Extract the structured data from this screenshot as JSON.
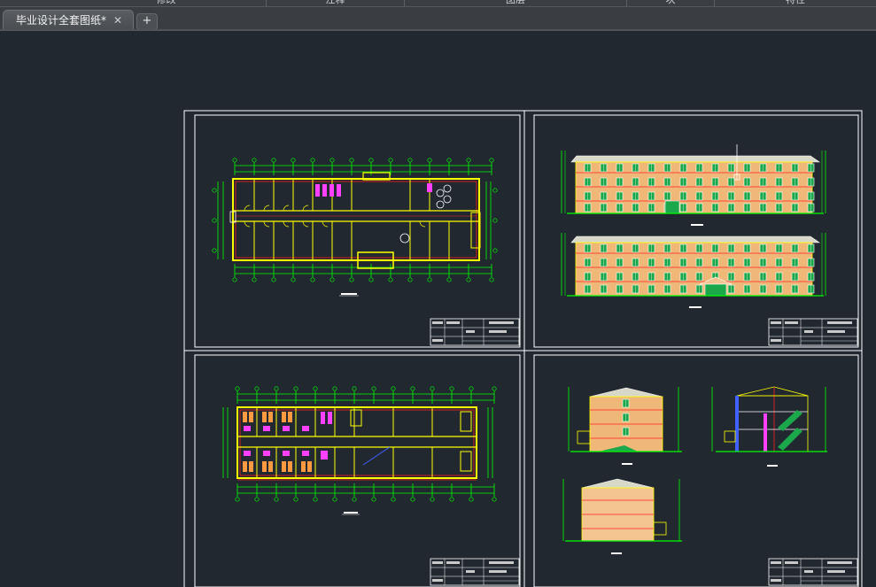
{
  "app": {
    "ribbon_groups": [
      "修改",
      "注释",
      "图层",
      "块",
      "特性"
    ]
  },
  "tabs": [
    {
      "label": "毕业设计全套图纸*",
      "active": true
    }
  ],
  "new_tab_label": "+",
  "close_glyph": "✕",
  "icons": {
    "close": "close-icon",
    "new_tab": "plus-icon"
  },
  "colors": {
    "canvas": "#212830",
    "sheet_border": "#ffffff",
    "green_lines": "#00ff00",
    "yellow_lines": "#ffff00",
    "red_lines": "#ff2020",
    "magenta": "#ff40ff",
    "facade_fill": "#f0b878",
    "facade_fill_alt": "#f4c490",
    "window_green": "#1aa84a"
  }
}
